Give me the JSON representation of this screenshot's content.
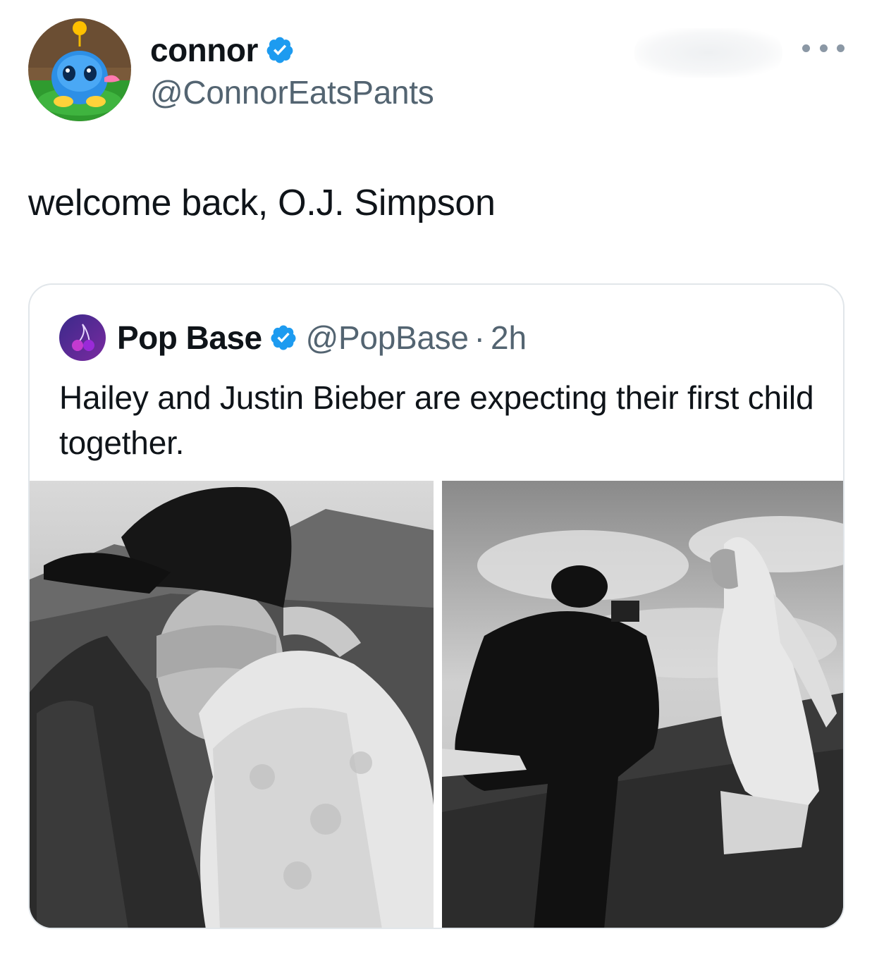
{
  "author": {
    "display_name": "connor",
    "handle": "@ConnorEatsPants",
    "verified_icon": "verified-badge-icon",
    "avatar_icon": "chao-avatar"
  },
  "tweet": {
    "text": "welcome back, O.J. Simpson"
  },
  "menu": {
    "icon": "more-options-icon"
  },
  "quoted": {
    "display_name": "Pop Base",
    "handle": "@PopBase",
    "separator": "·",
    "time": "2h",
    "text": "Hailey and Justin Bieber are expecting their first child together.",
    "photos": [
      {
        "name": "couple-embrace-photo"
      },
      {
        "name": "photographer-field-photo"
      }
    ]
  },
  "colors": {
    "verified_blue": "#1d9bf0",
    "text_primary": "#0f1419",
    "text_secondary": "#536471",
    "border": "#e1e6ea"
  }
}
